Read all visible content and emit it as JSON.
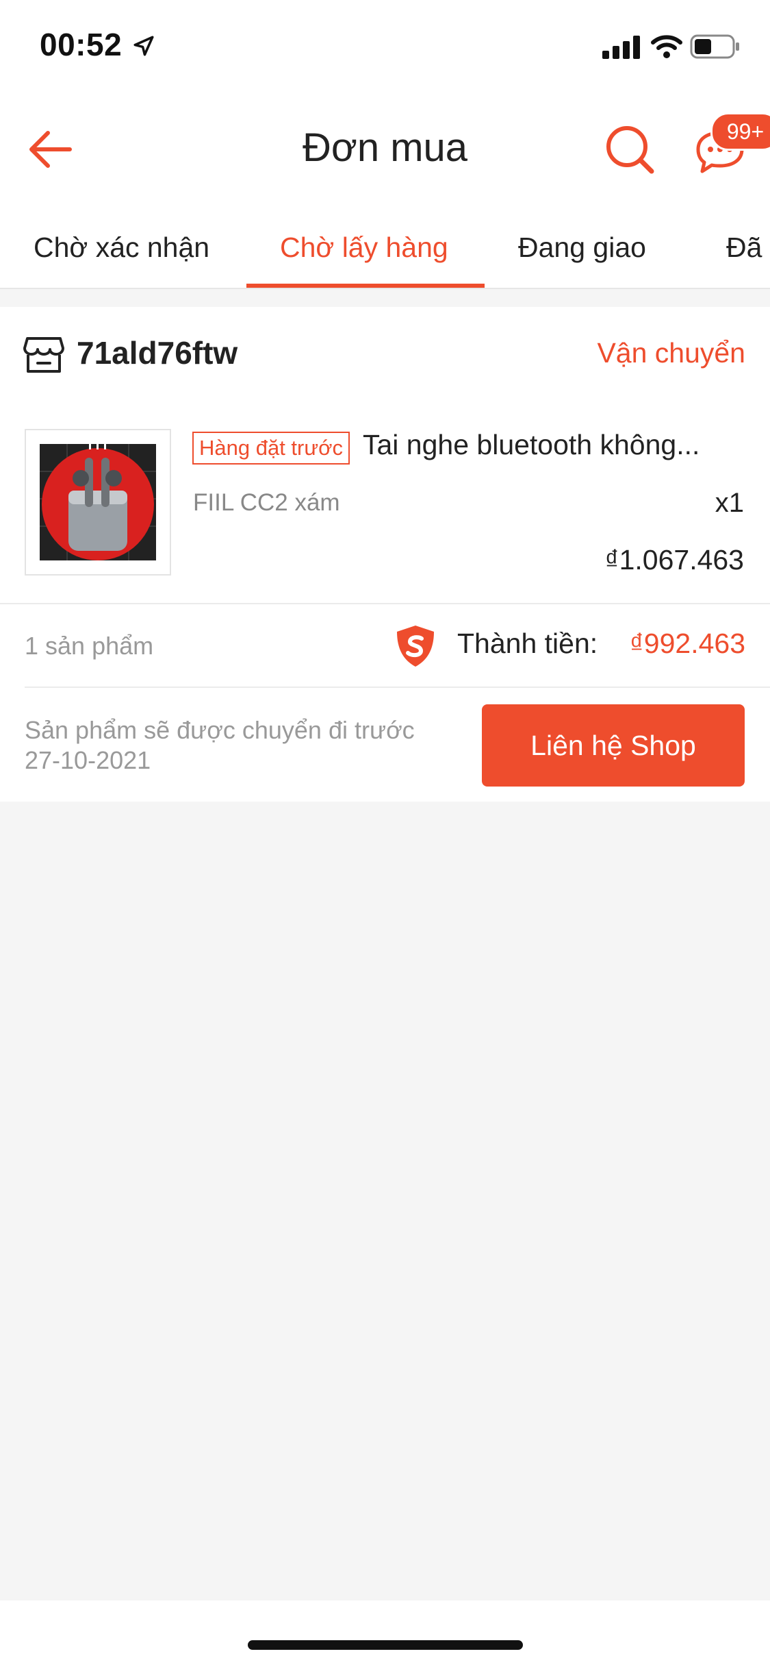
{
  "status_bar": {
    "time": "00:52"
  },
  "header": {
    "title": "Đơn mua",
    "chat_badge": "99+"
  },
  "tabs": [
    {
      "label": "Chờ xác nhận",
      "active": false
    },
    {
      "label": "Chờ lấy hàng",
      "active": true
    },
    {
      "label": "Đang giao",
      "active": false
    },
    {
      "label": "Đã",
      "active": false
    }
  ],
  "order": {
    "shop_name": "71ald76ftw",
    "shipping_status": "Vận chuyển",
    "product": {
      "tag": "Hàng đặt trước",
      "title": "Tai nghe bluetooth không...",
      "variant": "FIIL CC2 xám",
      "quantity": "x1",
      "price": "₫1.067.463"
    },
    "item_count": "1 sản phẩm",
    "total_label": "Thành tiền:",
    "total_value": "₫992.463",
    "ship_note": "Sản phẩm sẽ được chuyển đi trước 27-10-2021",
    "contact_button": "Liên hệ Shop"
  },
  "colors": {
    "accent": "#ee4d2d",
    "background": "#f5f5f5"
  }
}
